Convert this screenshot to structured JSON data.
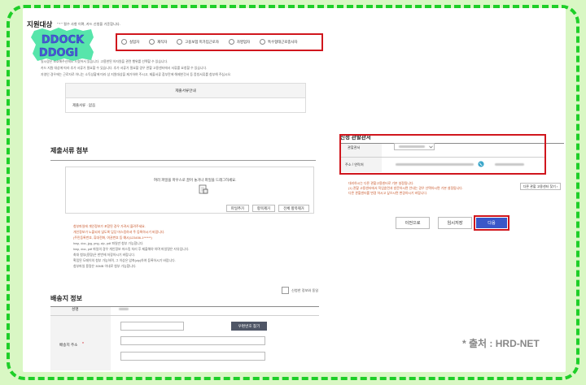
{
  "support_target": {
    "title": "지원대상",
    "required_note": "\" * \" 필수 사항 이며, 카드 신청을 기준합니다.",
    "options": [
      "실업자",
      "재직자",
      "고용보험 미가입근로자",
      "자영업자",
      "특수형태근로종사자"
    ],
    "notes": [
      "일시경은 보호해주신에도 드렸어서 있습니다. 고용한된 하자원을 관련 행위를 선택할 수 있습니다.",
      "카드 지원 대상에 따라 추가 서류가 필요할 수 있습니다. 추가 서류가 필요할 경우 관할 고용센터에서 서류를 요청할 수 있습니다.",
      "자영인 경우에는 근로자로 아니는 소득상황에 따라 상 지원대상을 제가하여 주시고, 제출서류 참부란에 해제한것서 등 증빙서류를 첨부해 주십시오."
    ],
    "doc_guide_header": "제출서류안내",
    "doc_guide_row": "제출서류 · 없음"
  },
  "attach": {
    "title": "제출서류 첨부",
    "drop_text": "여러 파일을 마우스로 끌어 놓거나 파일을 드래그하세요.",
    "buttons": [
      "파일추가",
      "항목제거",
      "전체 항목제거"
    ],
    "notes": [
      "첨부파일에 개인정보가 포함된 경우 가려서 올려주세요.",
      "개인정보가 노출되지 않도록 담당 마스킹하셔 주 등록하시기 바랍니다.",
      "(주민등록번호, 휴대전화, 여권번호 등 예시)123456-1******)",
      "hwp, doc, jpg, png, zip, pdf 파일만 첨부 가능합니다.",
      "hwp, doc, pdf 파일의 경우 개인정보 마스킹 처리 후 제출해야 하며 파일명은 자유입니다.",
      "최대 첨부(용량)은 한번에 저장하시기 바랍니다.",
      "확립된 도메이의 첨부 가능하며, 그 이상은 압축(zip)하여 등록하시기 바랍니다.",
      "첨부파일 용량은 30MB 이내로 첨부 가능합니다."
    ]
  },
  "office": {
    "title": "신청 관할관서",
    "row1_label": "관할관서",
    "row2_label": "주소 / 연락처",
    "notes": [
      "대리하시는 다른 관할고용센터로 기본 설정됩니다.",
      "(1) 관할 고용센터에서 직업훈련과 방문하시면 안내는 경우 선택하시면 기본 설정됩니다.",
      "다른 관할센터를 변경 하시고 싶으시면 변경하시기 바랍니다."
    ],
    "change_button": "다른 관할 고용센터 찾기"
  },
  "actions": {
    "prev": "이전으로",
    "save": "임시저장",
    "next": "다음"
  },
  "shipping": {
    "title": "배송지 정보",
    "same_as_applicant": "신청한 정보와 동일",
    "name_label": "성명",
    "address_label": "배송지 주소",
    "zip_button": "우편번호 찾기"
  },
  "logo_text": [
    "DDOCK",
    "DDOGI"
  ],
  "credit": "* 출처 : HRD-NET",
  "colors": {
    "frame": "#1ecf28",
    "background": "#d9f7c4",
    "highlight": "#d0161d",
    "next_button": "#3a57c9"
  }
}
